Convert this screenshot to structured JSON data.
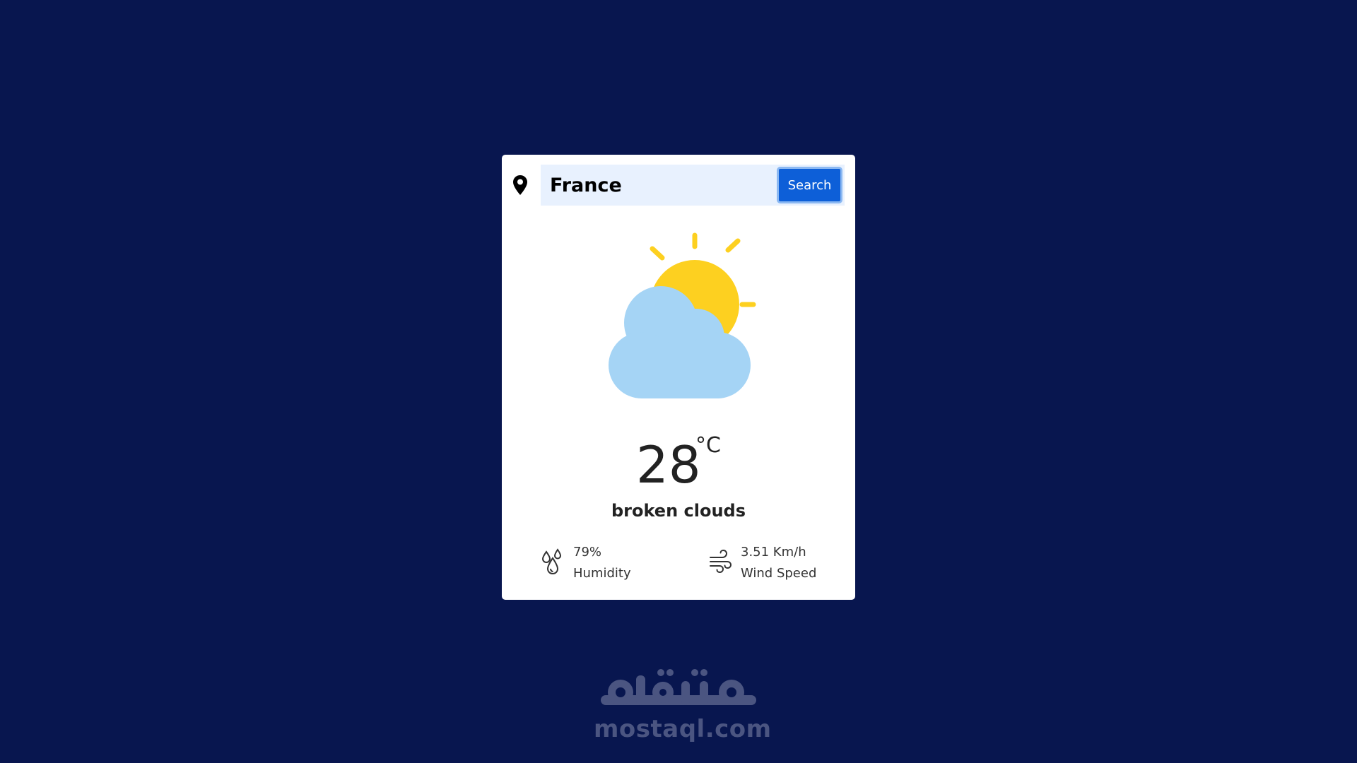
{
  "search": {
    "value": "France",
    "button_label": "Search"
  },
  "weather": {
    "icon": "partly-cloudy-icon",
    "temperature": "28",
    "unit": "°C",
    "description": "broken clouds"
  },
  "stats": {
    "humidity": {
      "value": "79%",
      "label": "Humidity",
      "icon": "humidity-icon"
    },
    "wind": {
      "value": "3.51 Km/h",
      "label": "Wind Speed",
      "icon": "wind-icon"
    }
  },
  "watermark": {
    "logo_text": "مستقل",
    "text": "mostaql.com"
  },
  "colors": {
    "background": "#08164f",
    "card": "#ffffff",
    "button": "#0d5fd8",
    "search_field": "#e8f1fe",
    "sun": "#fdd020",
    "cloud": "#a5d4f5"
  }
}
